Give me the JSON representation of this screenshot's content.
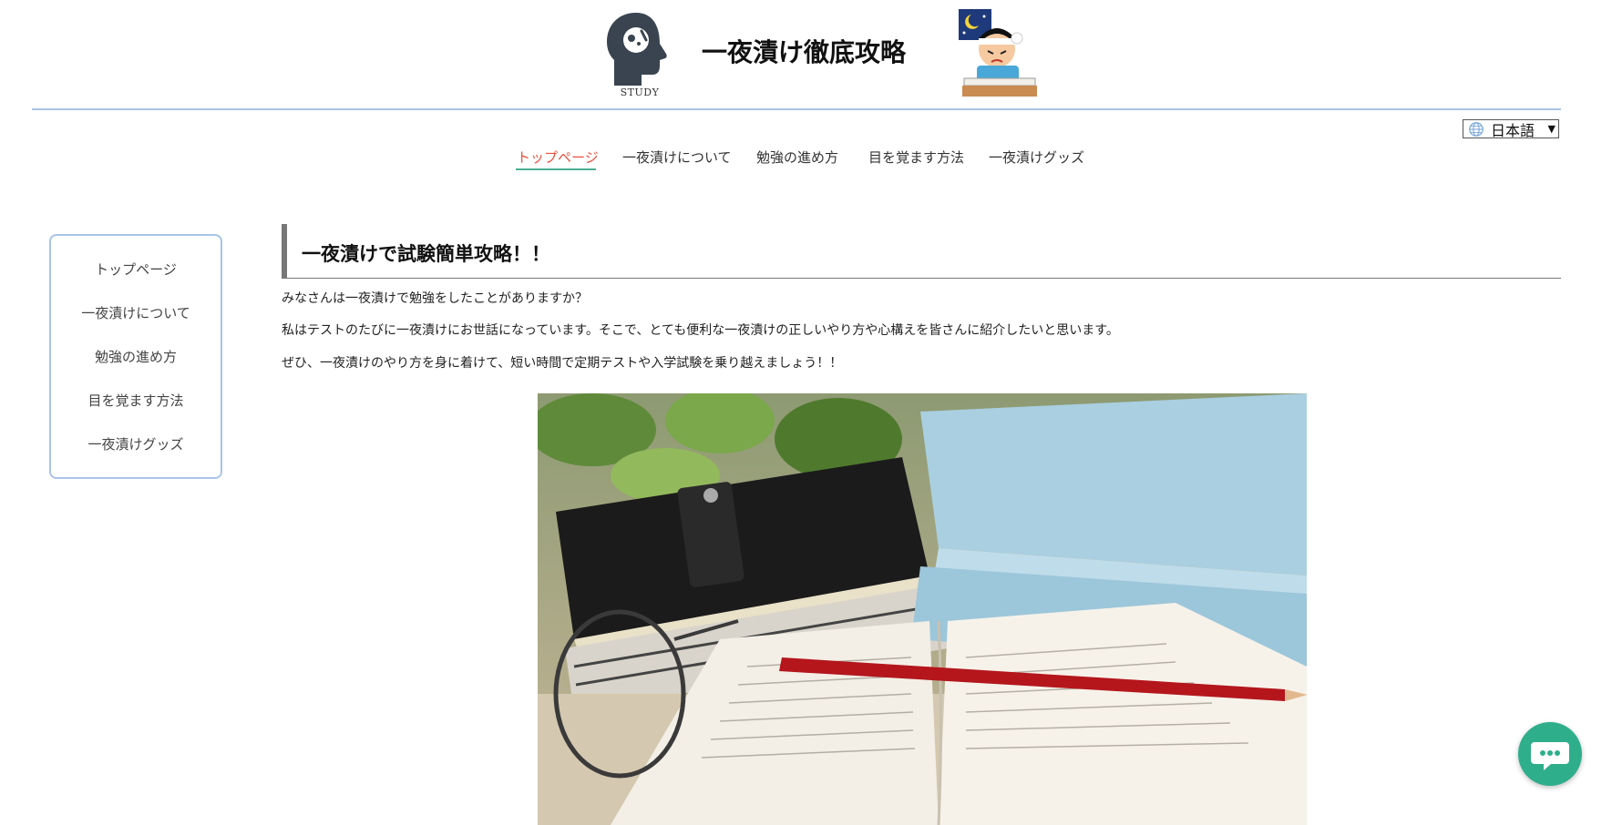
{
  "header": {
    "title": "一夜漬け徹底攻略",
    "logo_label": "STUDY"
  },
  "language": {
    "selected": "日本語"
  },
  "topnav": {
    "items": [
      "トップページ",
      "一夜漬けについて",
      "勉強の進め方",
      "目を覚ます方法",
      "一夜漬けグッズ"
    ],
    "active_index": 0
  },
  "sidebar": {
    "items": [
      "トップページ",
      "一夜漬けについて",
      "勉強の進め方",
      "目を覚ます方法",
      "一夜漬けグッズ"
    ]
  },
  "main": {
    "heading": "一夜漬けで試験簡単攻略！！",
    "paragraphs": [
      "みなさんは一夜漬けで勉強をしたことがありますか？",
      "私はテストのたびに一夜漬けにお世話になっています。そこで、とても便利な一夜漬けの正しいやり方や心構えを皆さんに紹介したいと思います。",
      "ぜひ、一夜漬けのやり方を身に着けて、短い時間で定期テストや入学試験を乗り越えましょう！！"
    ]
  },
  "colors": {
    "active_nav": "#e8533f",
    "nav_underline": "#4caf92",
    "header_rule": "#a9c4e6",
    "chat_button": "#2fae8b"
  },
  "icons": {
    "logo": "brain-head-icon",
    "student": "studying-student-illustration",
    "language": "globe-icon",
    "chat": "chat-bubble-icon"
  }
}
